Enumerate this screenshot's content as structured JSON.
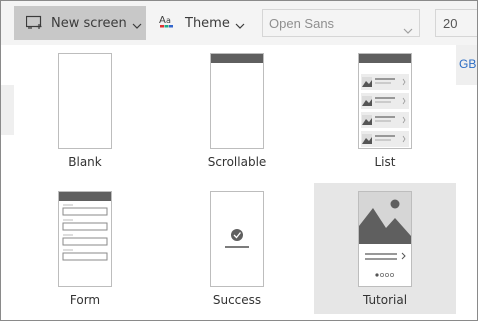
{
  "toolbar": {
    "new_screen_label": "New screen",
    "theme_label": "Theme",
    "font_value": "Open Sans",
    "size_value": "20"
  },
  "background": {
    "partial_text": "GB"
  },
  "gallery": {
    "tiles": [
      {
        "label": "Blank"
      },
      {
        "label": "Scrollable"
      },
      {
        "label": "List"
      },
      {
        "label": "Form"
      },
      {
        "label": "Success"
      },
      {
        "label": "Tutorial",
        "selected": true
      }
    ]
  },
  "colors": {
    "toolbar_bg": "#f4f4f4",
    "active_button_bg": "#c8c8c8",
    "selected_tile_bg": "#e6e6e6",
    "thumb_header": "#5f5f5f",
    "link_blue": "#2b6cc4"
  }
}
